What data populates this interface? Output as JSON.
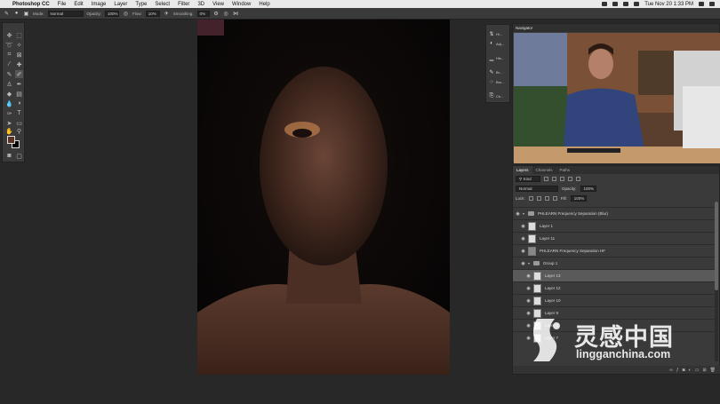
{
  "menubar": {
    "app_name": "Photoshop CC",
    "items": [
      "File",
      "Edit",
      "Image",
      "Layer",
      "Type",
      "Select",
      "Filter",
      "3D",
      "View",
      "Window",
      "Help"
    ],
    "clock": "Tue Nov 20  1:33 PM"
  },
  "options": {
    "mode_label": "Mode:",
    "mode_value": "Normal",
    "opacity_label": "Opacity:",
    "opacity_value": "100%",
    "flow_label": "Flow:",
    "flow_value": "10%",
    "smoothing_label": "Smoothing:",
    "smoothing_value": "0%"
  },
  "colors": {
    "foreground": "#5b3325",
    "background": "#000000",
    "selection": "#5a5a5a"
  },
  "adjustments": [
    {
      "icon": "adjustments-icon",
      "label": "Hi..."
    },
    {
      "icon": "properties-icon",
      "label": "Adj..."
    },
    {
      "icon": "histogram-icon",
      "label": "His..."
    },
    {
      "icon": "brush-settings-icon",
      "label": "Br..."
    },
    {
      "icon": "brushes-icon",
      "label": "Bru..."
    },
    {
      "icon": "channels-icon",
      "label": "Ch..."
    }
  ],
  "navigator": {
    "title": "Navigator"
  },
  "layers": {
    "tabs": [
      "Layers",
      "Channels",
      "Paths"
    ],
    "kind_label": "Kind",
    "blend_mode": "Normal",
    "opacity_label": "Opacity:",
    "opacity_value": "100%",
    "lock_label": "Lock:",
    "fill_label": "Fill:",
    "fill_value": "100%",
    "items": [
      {
        "name": "PHLEARN Frequency Separation (Blur)",
        "type": "group",
        "selected": false
      },
      {
        "name": "Layer 1",
        "type": "layer",
        "selected": false
      },
      {
        "name": "Layer 11",
        "type": "layer",
        "selected": false
      },
      {
        "name": "PHLEARN Frequency Separation HF",
        "type": "layer",
        "selected": false
      },
      {
        "name": "Group 1",
        "type": "group",
        "selected": false
      },
      {
        "name": "Layer 13",
        "type": "layer",
        "selected": true
      },
      {
        "name": "Layer 12",
        "type": "layer",
        "selected": false
      },
      {
        "name": "Layer 10",
        "type": "layer",
        "selected": false
      },
      {
        "name": "Layer 9",
        "type": "layer",
        "selected": false
      },
      {
        "name": "Layer 8",
        "type": "layer",
        "selected": false
      },
      {
        "name": "Layer 7",
        "type": "layer",
        "selected": false
      }
    ]
  },
  "watermark": {
    "cn": "灵感中国",
    "en": "lingganchina.com"
  }
}
